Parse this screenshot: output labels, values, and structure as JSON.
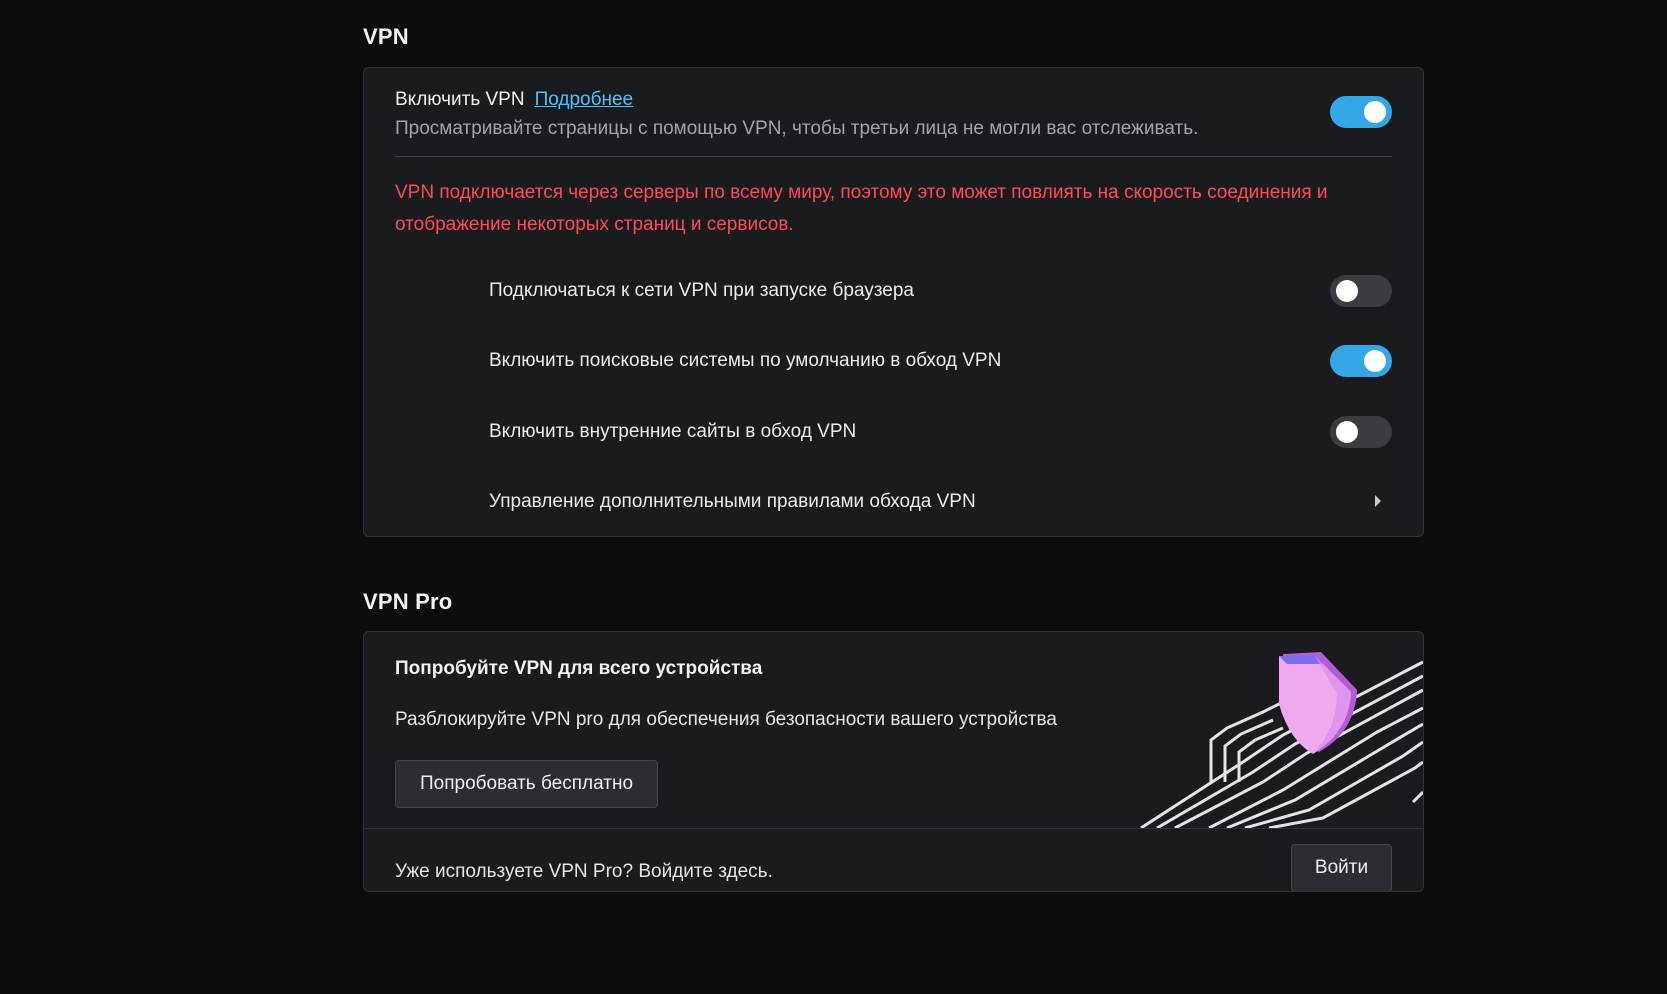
{
  "vpn": {
    "section_title": "VPN",
    "enable_label": "Включить VPN",
    "learn_more_link": "Подробнее",
    "enable_description": "Просматривайте страницы с помощью VPN, чтобы третьи лица не могли вас отслеживать.",
    "enable_state": "on",
    "warning": "VPN подключается через серверы по всему миру, поэтому это может повлиять на скорость соединения и отображение некоторых страниц и сервисов.",
    "options": [
      {
        "label": "Подключаться к сети VPN при запуске браузера",
        "state": "off"
      },
      {
        "label": "Включить поисковые системы по умолчанию в обход VPN",
        "state": "on"
      },
      {
        "label": "Включить внутренние сайты в обход VPN",
        "state": "off"
      }
    ],
    "manage_rules_label": "Управление дополнительными правилами обхода VPN"
  },
  "vpn_pro": {
    "section_title": "VPN Pro",
    "promo_title": "Попробуйте VPN для всего устройства",
    "promo_description": "Разблокируйте VPN pro для обеспечения безопасности вашего устройства",
    "try_free_button": "Попробовать бесплатно",
    "already_using_text": "Уже используете VPN Pro? Войдите здесь.",
    "login_button": "Войти"
  },
  "colors": {
    "background": "#0d0d0e",
    "card": "#1a1b1f",
    "accent": "#35a6e6",
    "link": "#4fc1ff",
    "warning": "#ff4a54",
    "shield_pink": "#f0a8ee",
    "shield_purple": "#b35bd9"
  }
}
